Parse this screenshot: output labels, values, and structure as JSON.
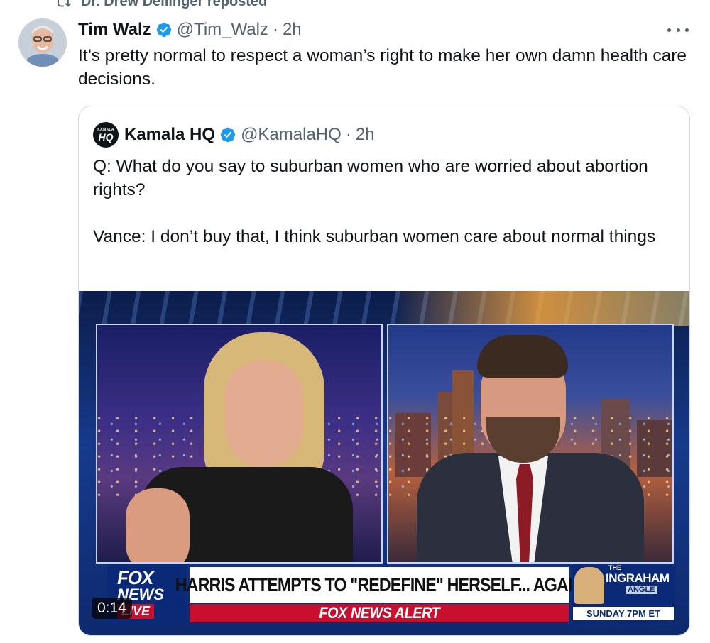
{
  "repost": {
    "text": "Dr. Drew Dellinger reposted"
  },
  "tweet": {
    "display_name": "Tim Walz",
    "handle": "@Tim_Walz",
    "dot": "·",
    "time": "2h",
    "text": "It’s pretty normal to respect a woman’s right to make her own damn health care decisions."
  },
  "quote": {
    "display_name": "Kamala HQ",
    "avatar_small": "KAMALA",
    "avatar_big": "HQ",
    "handle": "@KamalaHQ",
    "dot": "·",
    "time": "2h",
    "paragraph1": "Q: What do you say to suburban women who are worried about abortion rights?",
    "paragraph2": "Vance: I don’t buy that, I think suburban women care about normal things"
  },
  "video": {
    "duration": "0:14",
    "network_line1": "FOX",
    "network_line2": "NEWS",
    "network_line3": "LIVE",
    "headline": "HARRIS ATTEMPTS TO \"REDEFINE\" HERSELF... AGAIN",
    "alert": "FOX NEWS ALERT",
    "show_the": "THE",
    "show_name": "INGRAHAM",
    "show_sub": "ANGLE",
    "show_time": "SUNDAY 7PM ET"
  },
  "colors": {
    "text_primary": "#0f1419",
    "text_secondary": "#536471",
    "verified": "#1d9bf0",
    "border": "#cfd9de",
    "fox_blue": "#0a2a78",
    "fox_red": "#c8102e"
  },
  "icons": {
    "repost": "repost-icon",
    "verified": "verified-badge-icon",
    "more": "more-dots-icon"
  }
}
